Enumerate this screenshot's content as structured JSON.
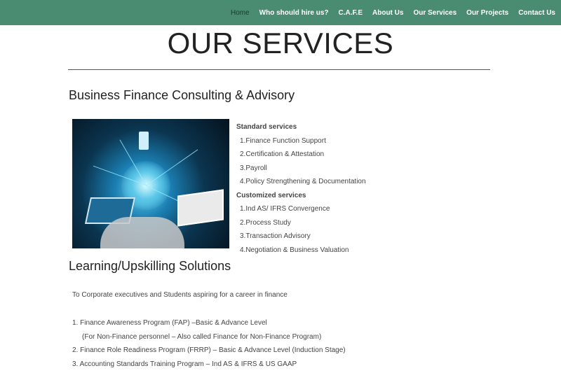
{
  "nav": {
    "items": [
      "Home",
      "Who should hire us?",
      "C.A.F.E",
      "About Us",
      "Our Services",
      "Our Projects",
      "Contact Us"
    ],
    "active": "Home"
  },
  "page": {
    "title": "OUR SERVICES"
  },
  "section1": {
    "heading": "Business Finance Consulting & Advisory",
    "standard_heading": "Standard services",
    "standard": [
      "1.Finance Function Support",
      "2.Certification & Attestation",
      "3.Payroll",
      "4.Policy Strengthening & Documentation"
    ],
    "custom_heading": "Customized services",
    "custom": [
      "1.Ind AS/ IFRS Convergence",
      "2.Process Study",
      "3.Transaction Advisory",
      "4.Negotiation & Business Valuation"
    ]
  },
  "section2": {
    "heading": "Learning/Upskilling Solutions",
    "intro": "To Corporate executives and Students aspiring for a career in finance",
    "programs": [
      "1. Finance Awareness Program (FAP) –Basic & Advance Level",
      "(For Non-Finance personnel – Also called Finance for Non-Finance Program)",
      "2. Finance Role Readiness Program (FRRP) – Basic & Advance Level (Induction Stage)",
      "3. Accounting Standards Training Program – Ind AS & IFRS & US GAAP"
    ]
  },
  "colors": {
    "header_bg": "#4a8c71",
    "nav_active": "#173a2c"
  }
}
